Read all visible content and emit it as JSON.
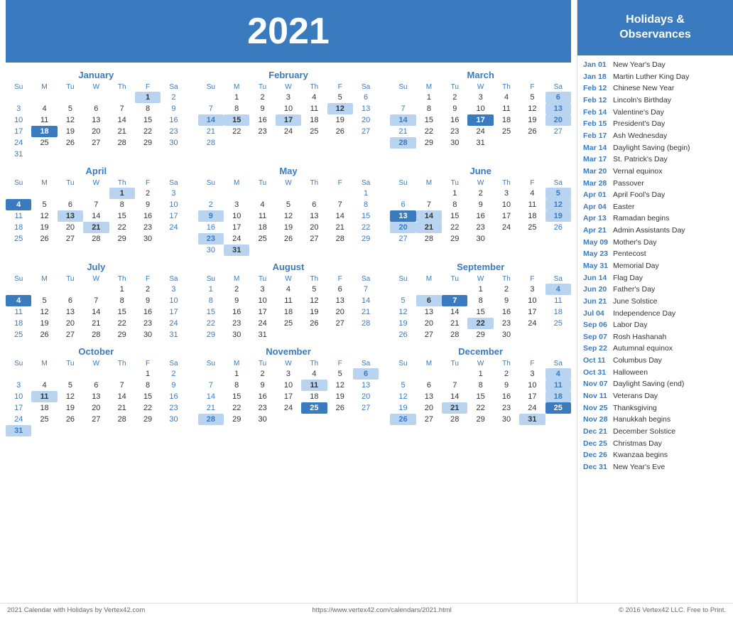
{
  "year": "2021",
  "months": [
    {
      "name": "January",
      "offset": 4,
      "days": 31,
      "highlighted": [
        1,
        18
      ],
      "rows": [
        [
          "",
          "",
          "",
          "",
          "",
          "1",
          "2"
        ],
        [
          "3",
          "4",
          "5",
          "6",
          "7",
          "8",
          "9"
        ],
        [
          "10",
          "11",
          "12",
          "13",
          "14",
          "15",
          "16"
        ],
        [
          "17",
          "18",
          "19",
          "20",
          "21",
          "22",
          "23"
        ],
        [
          "24",
          "25",
          "26",
          "27",
          "28",
          "29",
          "30"
        ],
        [
          "31",
          "",
          "",
          "",
          "",
          "",
          ""
        ]
      ],
      "specialDays": {
        "1": "holiday",
        "18": "today"
      }
    },
    {
      "name": "February",
      "offset": 0,
      "rows": [
        [
          "",
          "1",
          "2",
          "3",
          "4",
          "5",
          "6"
        ],
        [
          "7",
          "8",
          "9",
          "10",
          "11",
          "12",
          "13"
        ],
        [
          "14",
          "15",
          "16",
          "17",
          "18",
          "19",
          "20"
        ],
        [
          "21",
          "22",
          "23",
          "24",
          "25",
          "26",
          "27"
        ],
        [
          "28",
          "",
          "",
          "",
          "",
          "",
          ""
        ]
      ],
      "specialDays": {
        "12": "holiday",
        "14": "holiday",
        "15": "holiday",
        "17": "holiday"
      }
    },
    {
      "name": "March",
      "offset": 0,
      "rows": [
        [
          "",
          "1",
          "2",
          "3",
          "4",
          "5",
          "6"
        ],
        [
          "7",
          "8",
          "9",
          "10",
          "11",
          "12",
          "13"
        ],
        [
          "14",
          "15",
          "16",
          "17",
          "18",
          "19",
          "20"
        ],
        [
          "21",
          "22",
          "23",
          "24",
          "25",
          "26",
          "27"
        ],
        [
          "28",
          "29",
          "30",
          "31",
          "",
          "",
          ""
        ]
      ],
      "specialDays": {
        "6": "holiday",
        "13": "holiday",
        "14": "holiday",
        "17": "today",
        "20": "holiday",
        "28": "holiday"
      }
    },
    {
      "name": "April",
      "offset": 3,
      "rows": [
        [
          "",
          "",
          "",
          "",
          "1",
          "2",
          "3"
        ],
        [
          "4",
          "5",
          "6",
          "7",
          "8",
          "9",
          "10"
        ],
        [
          "11",
          "12",
          "13",
          "14",
          "15",
          "16",
          "17"
        ],
        [
          "18",
          "19",
          "20",
          "21",
          "22",
          "23",
          "24"
        ],
        [
          "25",
          "26",
          "27",
          "28",
          "29",
          "30",
          ""
        ]
      ],
      "specialDays": {
        "1": "holiday",
        "4": "today",
        "13": "holiday",
        "21": "holiday"
      }
    },
    {
      "name": "May",
      "offset": 6,
      "rows": [
        [
          "",
          "",
          "",
          "",
          "",
          "",
          "1"
        ],
        [
          "2",
          "3",
          "4",
          "5",
          "6",
          "7",
          "8"
        ],
        [
          "9",
          "10",
          "11",
          "12",
          "13",
          "14",
          "15"
        ],
        [
          "16",
          "17",
          "18",
          "19",
          "20",
          "21",
          "22"
        ],
        [
          "23",
          "24",
          "25",
          "26",
          "27",
          "28",
          "29"
        ],
        [
          "30",
          "31",
          "",
          "",
          "",
          "",
          ""
        ]
      ],
      "specialDays": {
        "9": "holiday",
        "23": "holiday",
        "31": "holiday"
      }
    },
    {
      "name": "June",
      "offset": 1,
      "rows": [
        [
          "",
          "",
          "1",
          "2",
          "3",
          "4",
          "5"
        ],
        [
          "6",
          "7",
          "8",
          "9",
          "10",
          "11",
          "12"
        ],
        [
          "13",
          "14",
          "15",
          "16",
          "17",
          "18",
          "19"
        ],
        [
          "20",
          "21",
          "22",
          "23",
          "24",
          "25",
          "26"
        ],
        [
          "27",
          "28",
          "29",
          "30",
          "",
          "",
          ""
        ]
      ],
      "specialDays": {
        "5": "holiday",
        "12": "holiday",
        "13": "today",
        "14": "holiday",
        "19": "holiday",
        "20": "holiday",
        "21": "holiday"
      }
    },
    {
      "name": "July",
      "offset": 3,
      "rows": [
        [
          "",
          "",
          "",
          "",
          "1",
          "2",
          "3"
        ],
        [
          "4",
          "5",
          "6",
          "7",
          "8",
          "9",
          "10"
        ],
        [
          "11",
          "12",
          "13",
          "14",
          "15",
          "16",
          "17"
        ],
        [
          "18",
          "19",
          "20",
          "21",
          "22",
          "23",
          "24"
        ],
        [
          "25",
          "26",
          "27",
          "28",
          "29",
          "30",
          "31"
        ]
      ],
      "specialDays": {
        "4": "today"
      }
    },
    {
      "name": "August",
      "offset": 0,
      "rows": [
        [
          "1",
          "2",
          "3",
          "4",
          "5",
          "6",
          "7"
        ],
        [
          "8",
          "9",
          "10",
          "11",
          "12",
          "13",
          "14"
        ],
        [
          "15",
          "16",
          "17",
          "18",
          "19",
          "20",
          "21"
        ],
        [
          "22",
          "23",
          "24",
          "25",
          "26",
          "27",
          "28"
        ],
        [
          "29",
          "30",
          "31",
          "",
          "",
          "",
          ""
        ]
      ],
      "specialDays": {}
    },
    {
      "name": "September",
      "offset": 2,
      "rows": [
        [
          "",
          "",
          "",
          "1",
          "2",
          "3",
          "4"
        ],
        [
          "5",
          "6",
          "7",
          "8",
          "9",
          "10",
          "11"
        ],
        [
          "12",
          "13",
          "14",
          "15",
          "16",
          "17",
          "18"
        ],
        [
          "19",
          "20",
          "21",
          "22",
          "23",
          "24",
          "25"
        ],
        [
          "26",
          "27",
          "28",
          "29",
          "30",
          "",
          ""
        ]
      ],
      "specialDays": {
        "4": "holiday",
        "6": "holiday",
        "7": "today",
        "22": "holiday"
      }
    },
    {
      "name": "October",
      "offset": 4,
      "rows": [
        [
          "",
          "",
          "",
          "",
          "",
          "1",
          "2"
        ],
        [
          "3",
          "4",
          "5",
          "6",
          "7",
          "8",
          "9"
        ],
        [
          "10",
          "11",
          "12",
          "13",
          "14",
          "15",
          "16"
        ],
        [
          "17",
          "18",
          "19",
          "20",
          "21",
          "22",
          "23"
        ],
        [
          "24",
          "25",
          "26",
          "27",
          "28",
          "29",
          "30"
        ],
        [
          "31",
          "",
          "",
          "",
          "",
          "",
          ""
        ]
      ],
      "specialDays": {
        "11": "holiday",
        "31": "holiday"
      }
    },
    {
      "name": "November",
      "offset": 0,
      "rows": [
        [
          "",
          "1",
          "2",
          "3",
          "4",
          "5",
          "6"
        ],
        [
          "7",
          "8",
          "9",
          "10",
          "11",
          "12",
          "13"
        ],
        [
          "14",
          "15",
          "16",
          "17",
          "18",
          "19",
          "20"
        ],
        [
          "21",
          "22",
          "23",
          "24",
          "25",
          "26",
          "27"
        ],
        [
          "28",
          "29",
          "30",
          "",
          "",
          "",
          ""
        ]
      ],
      "specialDays": {
        "6": "holiday",
        "11": "holiday",
        "25": "today",
        "28": "holiday"
      }
    },
    {
      "name": "December",
      "offset": 2,
      "rows": [
        [
          "",
          "",
          "",
          "1",
          "2",
          "3",
          "4"
        ],
        [
          "5",
          "6",
          "7",
          "8",
          "9",
          "10",
          "11"
        ],
        [
          "12",
          "13",
          "14",
          "15",
          "16",
          "17",
          "18"
        ],
        [
          "19",
          "20",
          "21",
          "22",
          "23",
          "24",
          "25"
        ],
        [
          "26",
          "27",
          "28",
          "29",
          "30",
          "31",
          ""
        ]
      ],
      "specialDays": {
        "4": "holiday",
        "11": "holiday",
        "18": "holiday",
        "21": "holiday",
        "25": "today",
        "26": "holiday",
        "31": "holiday"
      }
    }
  ],
  "holidays_header": "Holidays &\nObservances",
  "holidays": [
    {
      "date": "Jan 01",
      "name": "New Year's Day"
    },
    {
      "date": "Jan 18",
      "name": "Martin Luther King Day"
    },
    {
      "date": "Feb 12",
      "name": "Chinese New Year"
    },
    {
      "date": "Feb 12",
      "name": "Lincoln's Birthday"
    },
    {
      "date": "Feb 14",
      "name": "Valentine's Day"
    },
    {
      "date": "Feb 15",
      "name": "President's Day"
    },
    {
      "date": "Feb 17",
      "name": "Ash Wednesday"
    },
    {
      "date": "Mar 14",
      "name": "Daylight Saving (begin)"
    },
    {
      "date": "Mar 17",
      "name": "St. Patrick's Day"
    },
    {
      "date": "Mar 20",
      "name": "Vernal equinox"
    },
    {
      "date": "Mar 28",
      "name": "Passover"
    },
    {
      "date": "Apr 01",
      "name": "April Fool's Day"
    },
    {
      "date": "Apr 04",
      "name": "Easter"
    },
    {
      "date": "Apr 13",
      "name": "Ramadan begins"
    },
    {
      "date": "Apr 21",
      "name": "Admin Assistants Day"
    },
    {
      "date": "May 09",
      "name": "Mother's Day"
    },
    {
      "date": "May 23",
      "name": "Pentecost"
    },
    {
      "date": "May 31",
      "name": "Memorial Day"
    },
    {
      "date": "Jun 14",
      "name": "Flag Day"
    },
    {
      "date": "Jun 20",
      "name": "Father's Day"
    },
    {
      "date": "Jun 21",
      "name": "June Solstice"
    },
    {
      "date": "Jul 04",
      "name": "Independence Day"
    },
    {
      "date": "Sep 06",
      "name": "Labor Day"
    },
    {
      "date": "Sep 07",
      "name": "Rosh Hashanah"
    },
    {
      "date": "Sep 22",
      "name": "Autumnal equinox"
    },
    {
      "date": "Oct 11",
      "name": "Columbus Day"
    },
    {
      "date": "Oct 31",
      "name": "Halloween"
    },
    {
      "date": "Nov 07",
      "name": "Daylight Saving (end)"
    },
    {
      "date": "Nov 11",
      "name": "Veterans Day"
    },
    {
      "date": "Nov 25",
      "name": "Thanksgiving"
    },
    {
      "date": "Nov 28",
      "name": "Hanukkah begins"
    },
    {
      "date": "Dec 21",
      "name": "December Solstice"
    },
    {
      "date": "Dec 25",
      "name": "Christmas Day"
    },
    {
      "date": "Dec 26",
      "name": "Kwanzaa begins"
    },
    {
      "date": "Dec 31",
      "name": "New Year's Eve"
    }
  ],
  "footer": {
    "left": "2021 Calendar with Holidays by Vertex42.com",
    "center": "https://www.vertex42.com/calendars/2021.html",
    "right": "© 2016 Vertex42 LLC. Free to Print."
  },
  "weekdays": [
    "Su",
    "M",
    "Tu",
    "W",
    "Th",
    "F",
    "Sa"
  ]
}
